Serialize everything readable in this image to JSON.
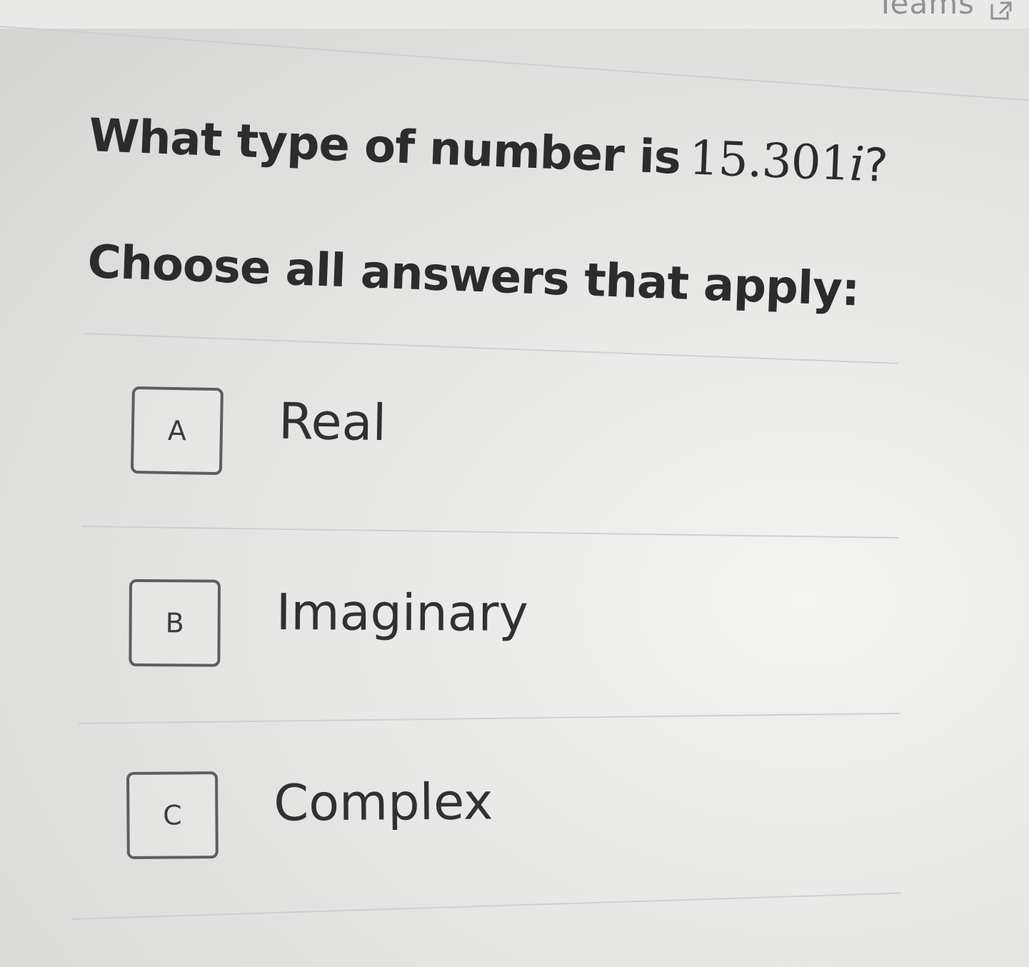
{
  "header": {
    "link_label": "Teams",
    "link_icon": "external-link-icon"
  },
  "question": {
    "prompt": "What type of number is",
    "number": "15.301",
    "imaginary_unit": "i",
    "end_mark": "?",
    "instruction": "Choose all answers that apply:"
  },
  "choices": [
    {
      "letter": "A",
      "label": "Real"
    },
    {
      "letter": "B",
      "label": "Imaginary"
    },
    {
      "letter": "C",
      "label": "Complex"
    }
  ],
  "colors": {
    "text": "#2d2f31",
    "box_border": "#5b5e61",
    "divider": "#cdcfd1"
  }
}
